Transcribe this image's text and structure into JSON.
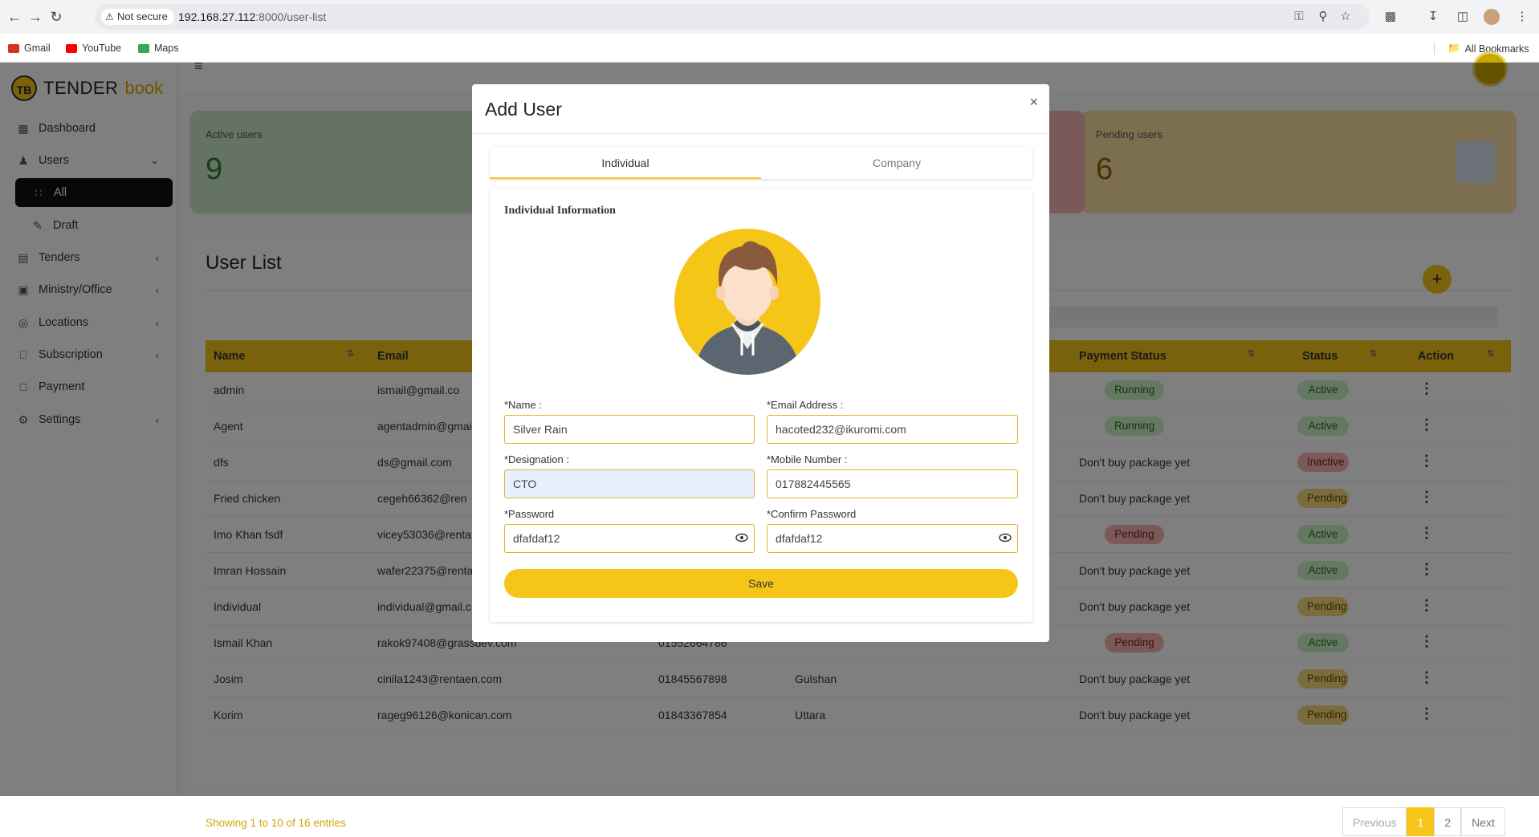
{
  "browser": {
    "not_secure": "Not secure",
    "url_host": "192.168.27.112",
    "url_rest": ":8000/user-list",
    "bookmarks": [
      {
        "label": "Gmail",
        "color": "#d93025"
      },
      {
        "label": "YouTube",
        "color": "#ff0000"
      },
      {
        "label": "Maps",
        "color": "#34a853"
      }
    ],
    "all_bookmarks": "All Bookmarks"
  },
  "logo": {
    "tb": "TB",
    "part1": "TENDER",
    "part2": "book"
  },
  "sidebar": {
    "items": [
      {
        "label": "Dashboard",
        "icon": "dashboard-icon"
      },
      {
        "label": "Users",
        "icon": "users-icon"
      },
      {
        "label": "All",
        "icon": "grid-icon"
      },
      {
        "label": "Draft",
        "icon": "draft-icon"
      },
      {
        "label": "Tenders",
        "icon": "tenders-icon"
      },
      {
        "label": "Ministry/Office",
        "icon": "office-icon"
      },
      {
        "label": "Locations",
        "icon": "location-icon"
      },
      {
        "label": "Subscription",
        "icon": "subscription-icon"
      },
      {
        "label": "Payment",
        "icon": "payment-icon"
      },
      {
        "label": "Settings",
        "icon": "settings-icon"
      }
    ]
  },
  "cards": {
    "active": {
      "label": "Active users",
      "value": "9",
      "color": "#c8e6c9"
    },
    "pending": {
      "label": "Pending users",
      "value": "6",
      "color": "#f6dfa0"
    }
  },
  "user_list": {
    "title": "User List",
    "columns": {
      "name": "Name",
      "email": "Email",
      "payment": "Payment Status",
      "status": "Status",
      "action": "Action"
    },
    "rows": [
      {
        "name": "admin",
        "email": "ismail@gmail.co",
        "mobile": "",
        "location": "",
        "payment": "Running",
        "payment_style": "green",
        "status": "Active",
        "status_style": "green"
      },
      {
        "name": "Agent",
        "email": "agentadmin@gmai",
        "mobile": "",
        "location": "",
        "payment": "Running",
        "payment_style": "green",
        "status": "Active",
        "status_style": "green"
      },
      {
        "name": "dfs",
        "email": "ds@gmail.com",
        "mobile": "",
        "location": "",
        "payment": "Don't buy package yet",
        "payment_style": "text",
        "status": "Inactive",
        "status_style": "red"
      },
      {
        "name": "Fried chicken",
        "email": "cegeh66362@ren",
        "mobile": "",
        "location": "",
        "payment": "Don't buy package yet",
        "payment_style": "text",
        "status": "Pending",
        "status_style": "yellow"
      },
      {
        "name": "Imo Khan fsdf",
        "email": "vicey53036@renta",
        "mobile": "",
        "location": "",
        "payment": "Pending",
        "payment_style": "red",
        "status": "Active",
        "status_style": "green"
      },
      {
        "name": "Imran Hossain",
        "email": "wafer22375@renta",
        "mobile": "",
        "location": "",
        "payment": "Don't buy package yet",
        "payment_style": "text",
        "status": "Active",
        "status_style": "green"
      },
      {
        "name": "Individual",
        "email": "individual@gmail.c",
        "mobile": "",
        "location": "",
        "payment": "Don't buy package yet",
        "payment_style": "text",
        "status": "Pending",
        "status_style": "yellow"
      },
      {
        "name": "Ismail Khan",
        "email": "rakok97408@grassdev.com",
        "mobile": "01552664786",
        "location": "",
        "payment": "Pending",
        "payment_style": "red",
        "status": "Active",
        "status_style": "green"
      },
      {
        "name": "Josim",
        "email": "cinila1243@rentaen.com",
        "mobile": "01845567898",
        "location": "Gulshan",
        "payment": "Don't buy package yet",
        "payment_style": "text",
        "status": "Pending",
        "status_style": "yellow"
      },
      {
        "name": "Korim",
        "email": "rageg96126@konican.com",
        "mobile": "01843367854",
        "location": "Uttara",
        "payment": "Don't buy package yet",
        "payment_style": "text",
        "status": "Pending",
        "status_style": "yellow"
      }
    ],
    "showing": "Showing 1 to 10 of 16 entries",
    "pager": {
      "prev": "Previous",
      "p1": "1",
      "p2": "2",
      "next": "Next"
    }
  },
  "modal": {
    "title": "Add User",
    "close": "×",
    "tabs": {
      "individual": "Individual",
      "company": "Company"
    },
    "section_title": "Individual Information",
    "fields": {
      "name_label": "*Name :",
      "name_value": "Silver Rain",
      "email_label": "*Email Address :",
      "email_value": "hacoted232@ikuromi.com",
      "designation_label": "*Designation :",
      "designation_value": "CTO",
      "mobile_label": "*Mobile Number :",
      "mobile_value": "017882445565",
      "password_label": "*Password",
      "password_value": "dfafdaf12",
      "confirm_label": "*Confirm Password",
      "confirm_value": "dfafdaf12"
    },
    "save": "Save"
  }
}
